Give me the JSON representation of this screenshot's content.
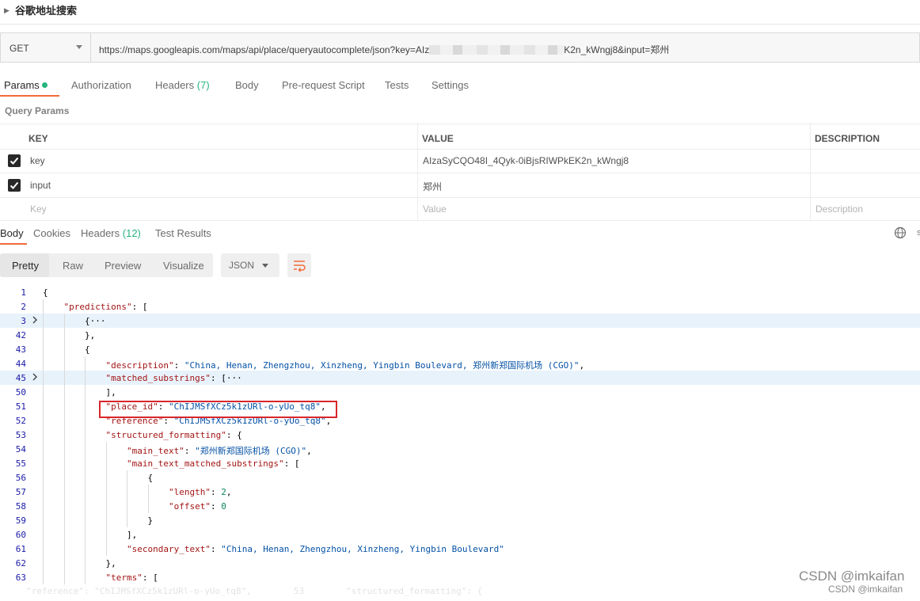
{
  "request": {
    "name": "谷歌地址搜索"
  },
  "url_bar": {
    "method": "GET",
    "url_prefix": "https://maps.googleapis.com/maps/api/place/queryautocomplete/json?key=AIz",
    "url_suffix": "K2n_kWngj8&input=郑州"
  },
  "request_tabs": [
    {
      "label": "Params",
      "count": ""
    },
    {
      "label": "Authorization",
      "count": ""
    },
    {
      "label": "Headers",
      "count": "(7)"
    },
    {
      "label": "Body",
      "count": ""
    },
    {
      "label": "Pre-request Script",
      "count": ""
    },
    {
      "label": "Tests",
      "count": ""
    },
    {
      "label": "Settings",
      "count": ""
    }
  ],
  "query_params": {
    "title": "Query Params",
    "headers": {
      "key": "KEY",
      "value": "VALUE",
      "description": "DESCRIPTION"
    },
    "rows": [
      {
        "checked": true,
        "key": "key",
        "value": "AIzaSyCQO48I_4Qyk-0iBjsRIWPkEK2n_kWngj8",
        "description": ""
      },
      {
        "checked": true,
        "key": "input",
        "value": "郑州",
        "description": ""
      }
    ],
    "placeholders": {
      "key": "Key",
      "value": "Value",
      "description": "Description"
    }
  },
  "response_tabs": [
    {
      "label": "Body",
      "count": ""
    },
    {
      "label": "Cookies",
      "count": ""
    },
    {
      "label": "Headers",
      "count": "(12)"
    },
    {
      "label": "Test Results",
      "count": ""
    }
  ],
  "view_modes": [
    "Pretty",
    "Raw",
    "Preview",
    "Visualize"
  ],
  "format": "JSON",
  "code_lines": [
    {
      "n": "1",
      "indent": 0,
      "fold": false,
      "hl": false,
      "tokens": [
        [
          "p",
          "{"
        ]
      ]
    },
    {
      "n": "2",
      "indent": 1,
      "fold": false,
      "hl": false,
      "tokens": [
        [
          "k",
          "\"predictions\""
        ],
        [
          "p",
          ": ["
        ]
      ]
    },
    {
      "n": "3",
      "indent": 2,
      "fold": true,
      "hl": true,
      "tokens": [
        [
          "p",
          "{···"
        ]
      ]
    },
    {
      "n": "42",
      "indent": 2,
      "fold": false,
      "hl": false,
      "tokens": [
        [
          "p",
          "},"
        ]
      ]
    },
    {
      "n": "43",
      "indent": 2,
      "fold": false,
      "hl": false,
      "tokens": [
        [
          "p",
          "{"
        ]
      ]
    },
    {
      "n": "44",
      "indent": 3,
      "fold": false,
      "hl": false,
      "tokens": [
        [
          "k",
          "\"description\""
        ],
        [
          "p",
          ": "
        ],
        [
          "s",
          "\"China, Henan, Zhengzhou, Xinzheng, Yingbin Boulevard, 郑州新郑国际机场 (CGO)\""
        ],
        [
          "p",
          ","
        ]
      ]
    },
    {
      "n": "45",
      "indent": 3,
      "fold": true,
      "hl": true,
      "tokens": [
        [
          "k",
          "\"matched_substrings\""
        ],
        [
          "p",
          ": [···"
        ]
      ]
    },
    {
      "n": "50",
      "indent": 3,
      "fold": false,
      "hl": false,
      "tokens": [
        [
          "p",
          "],"
        ]
      ]
    },
    {
      "n": "51",
      "indent": 3,
      "fold": false,
      "hl": false,
      "tokens": [
        [
          "k",
          "\"place_id\""
        ],
        [
          "p",
          ": "
        ],
        [
          "s",
          "\"ChIJMSfXCz5k1zURl-o-yUo_tq8\""
        ],
        [
          "p",
          ","
        ]
      ]
    },
    {
      "n": "52",
      "indent": 3,
      "fold": false,
      "hl": false,
      "tokens": [
        [
          "k",
          "\"reference\""
        ],
        [
          "p",
          ": "
        ],
        [
          "s",
          "\"ChIJMSfXCz5k1zURl-o-yUo_tq8\""
        ],
        [
          "p",
          ","
        ]
      ]
    },
    {
      "n": "53",
      "indent": 3,
      "fold": false,
      "hl": false,
      "tokens": [
        [
          "k",
          "\"structured_formatting\""
        ],
        [
          "p",
          ": {"
        ]
      ]
    },
    {
      "n": "54",
      "indent": 4,
      "fold": false,
      "hl": false,
      "tokens": [
        [
          "k",
          "\"main_text\""
        ],
        [
          "p",
          ": "
        ],
        [
          "s",
          "\"郑州新郑国际机场 (CGO)\""
        ],
        [
          "p",
          ","
        ]
      ]
    },
    {
      "n": "55",
      "indent": 4,
      "fold": false,
      "hl": false,
      "tokens": [
        [
          "k",
          "\"main_text_matched_substrings\""
        ],
        [
          "p",
          ": ["
        ]
      ]
    },
    {
      "n": "56",
      "indent": 5,
      "fold": false,
      "hl": false,
      "tokens": [
        [
          "p",
          "{"
        ]
      ]
    },
    {
      "n": "57",
      "indent": 6,
      "fold": false,
      "hl": false,
      "tokens": [
        [
          "k",
          "\"length\""
        ],
        [
          "p",
          ": "
        ],
        [
          "n",
          "2"
        ],
        [
          "p",
          ","
        ]
      ]
    },
    {
      "n": "58",
      "indent": 6,
      "fold": false,
      "hl": false,
      "tokens": [
        [
          "k",
          "\"offset\""
        ],
        [
          "p",
          ": "
        ],
        [
          "n",
          "0"
        ]
      ]
    },
    {
      "n": "59",
      "indent": 5,
      "fold": false,
      "hl": false,
      "tokens": [
        [
          "p",
          "}"
        ]
      ]
    },
    {
      "n": "60",
      "indent": 4,
      "fold": false,
      "hl": false,
      "tokens": [
        [
          "p",
          "],"
        ]
      ]
    },
    {
      "n": "61",
      "indent": 4,
      "fold": false,
      "hl": false,
      "tokens": [
        [
          "k",
          "\"secondary_text\""
        ],
        [
          "p",
          ": "
        ],
        [
          "s",
          "\"China, Henan, Zhengzhou, Xinzheng, Yingbin Boulevard\""
        ]
      ]
    },
    {
      "n": "62",
      "indent": 3,
      "fold": false,
      "hl": false,
      "tokens": [
        [
          "p",
          "},"
        ]
      ]
    },
    {
      "n": "63",
      "indent": 3,
      "fold": false,
      "hl": false,
      "tokens": [
        [
          "k",
          "\"terms\""
        ],
        [
          "p",
          ": ["
        ]
      ]
    }
  ],
  "watermark": {
    "large": "CSDN @imkaifan",
    "small": "CSDN @imkaifan"
  },
  "colors": {
    "accent": "#f26b3a",
    "count_green": "#26b47f",
    "highlight_box": "#d9262b"
  }
}
